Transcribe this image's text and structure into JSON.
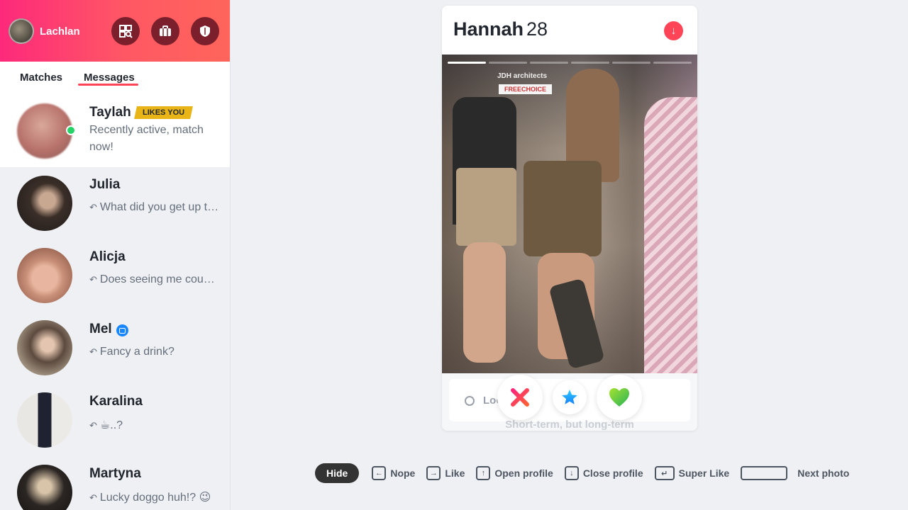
{
  "user": {
    "name": "Lachlan"
  },
  "tabs": {
    "matches": "Matches",
    "messages": "Messages"
  },
  "conversations": [
    {
      "name": "Taylah",
      "badge": "LIKES YOU",
      "message": "Recently active, match now!"
    },
    {
      "name": "Julia",
      "message": "What did you get up to today?"
    },
    {
      "name": "Alicja",
      "message": "Does seeing me count as a date?"
    },
    {
      "name": "Mel",
      "message": "Fancy a drink?"
    },
    {
      "name": "Karalina",
      "message": "☕..?"
    },
    {
      "name": "Martyna",
      "message": "Lucky doggo huh!? 😉"
    }
  ],
  "profile": {
    "name": "Hannah",
    "age": "28",
    "photo_count": 6,
    "current_photo": 1
  },
  "photo_signs": {
    "sign_top": "JDH architects",
    "sign_free": "FREECHOICE"
  },
  "looking_for": {
    "label": "Looking for",
    "value": "Short-term, but long-term"
  },
  "shortcuts": {
    "hide": "Hide",
    "nope": "Nope",
    "like": "Like",
    "open_profile": "Open profile",
    "close_profile": "Close profile",
    "super_like": "Super Like",
    "next_photo": "Next photo"
  },
  "colors": {
    "brand_start": "#fd297b",
    "brand_end": "#ff655b",
    "badge": "#e8b416",
    "online": "#25d366"
  }
}
